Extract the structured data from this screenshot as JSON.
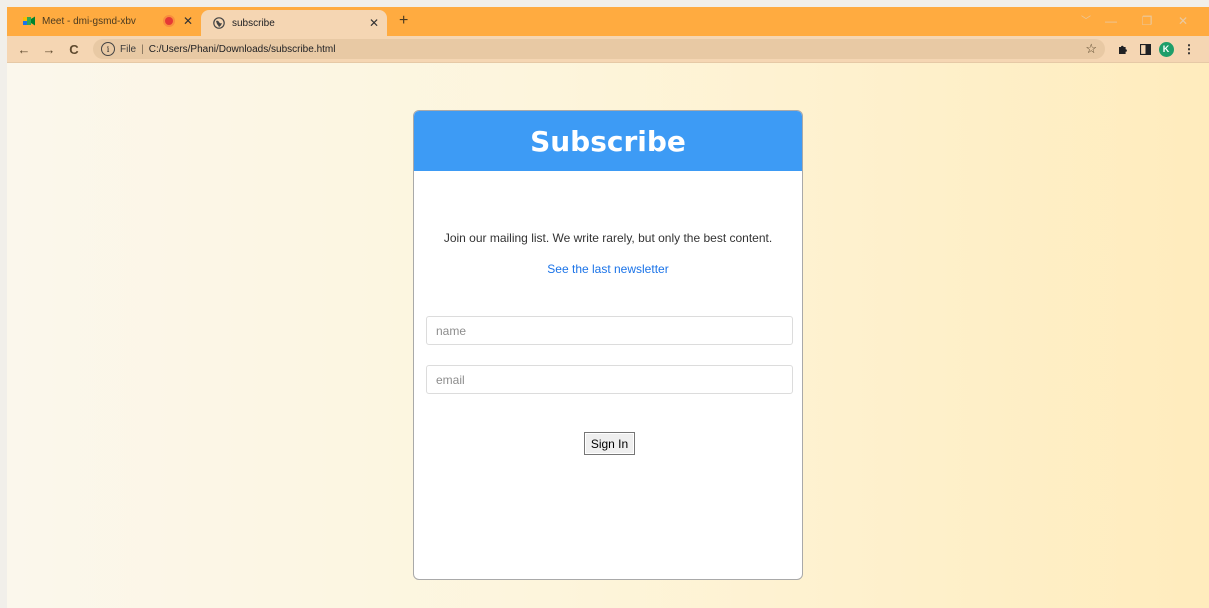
{
  "browser": {
    "tabs": [
      {
        "title": "Meet - dmi-gsmd-xbv",
        "favicon": "google-meet-icon",
        "recording": true,
        "active": false
      },
      {
        "title": "subscribe",
        "favicon": "globe-icon",
        "recording": false,
        "active": true
      }
    ],
    "new_tab": "+",
    "address": {
      "scheme_label": "File",
      "separator": "|",
      "url": "C:/Users/Phani/Downloads/subscribe.html"
    },
    "profile_initial": "K",
    "colors": {
      "tabbar": "#ffab40",
      "toolbar": "#f5d6b3",
      "avatar": "#1e9e6a"
    }
  },
  "page": {
    "title": "Subscribe",
    "description": "Join our mailing list. We write rarely, but only the best content.",
    "link_text": "See the last newsletter",
    "form": {
      "name_placeholder": "name",
      "email_placeholder": "email",
      "submit_label": "Sign In"
    },
    "colors": {
      "header": "#3d9bf5",
      "link": "#1a73e8"
    }
  }
}
